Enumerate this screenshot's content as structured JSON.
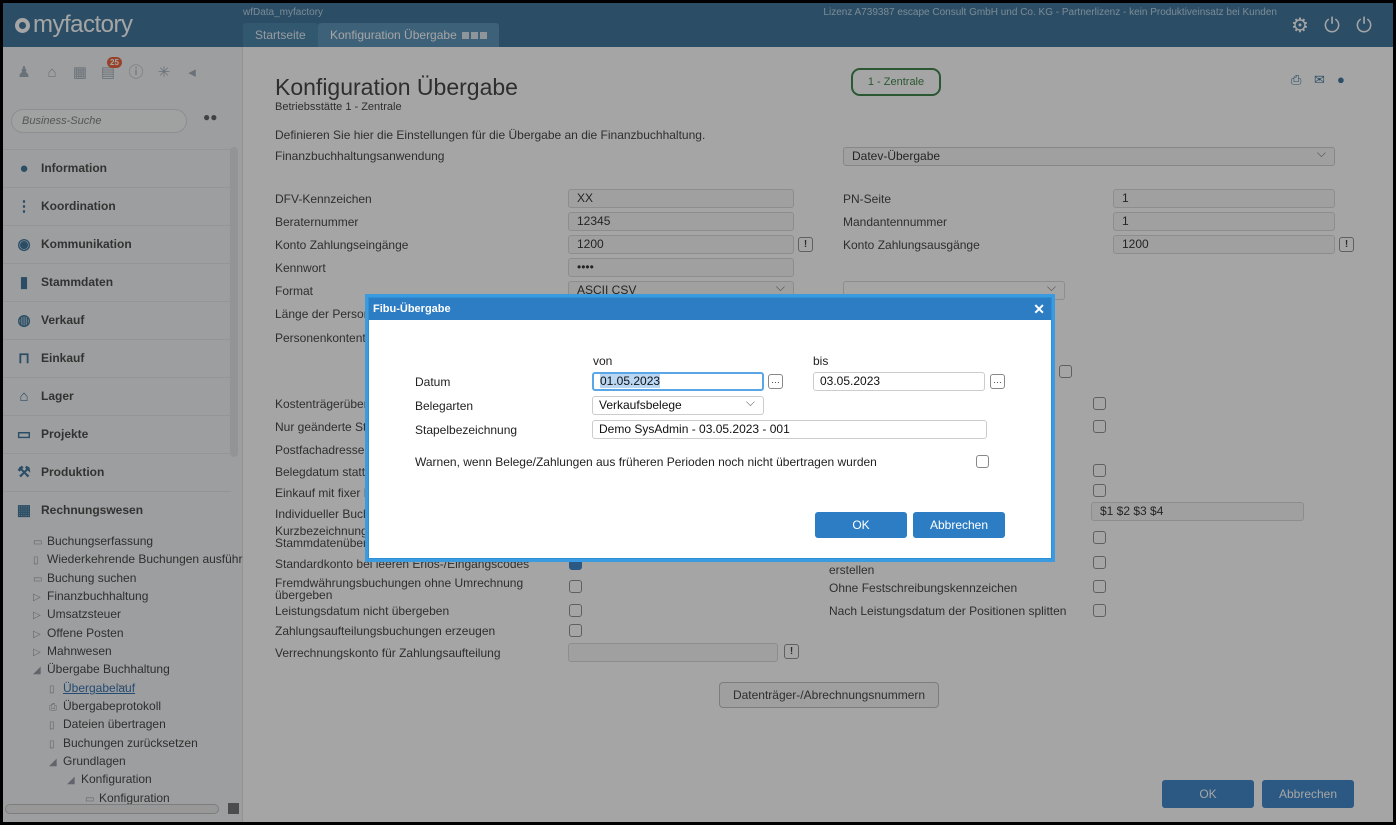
{
  "app": {
    "logo": "myfactory",
    "database": "wfData_myfactory",
    "license": "Lizenz A739387 escape Consult GmbH und Co. KG - Partnerlizenz - kein Produktiveinsatz bei Kunden",
    "tabs": [
      {
        "label": "Startseite"
      },
      {
        "label": "Konfiguration Übergabe"
      }
    ]
  },
  "sidebar": {
    "notification_count": "25",
    "search_placeholder": "Business-Suche",
    "nav": [
      {
        "label": "Information"
      },
      {
        "label": "Koordination"
      },
      {
        "label": "Kommunikation"
      },
      {
        "label": "Stammdaten"
      },
      {
        "label": "Verkauf"
      },
      {
        "label": "Einkauf"
      },
      {
        "label": "Lager"
      },
      {
        "label": "Projekte"
      },
      {
        "label": "Produktion"
      },
      {
        "label": "Rechnungswesen"
      }
    ],
    "tree": [
      {
        "label": "Buchungserfassung"
      },
      {
        "label": "Wiederkehrende Buchungen ausführe"
      },
      {
        "label": "Buchung suchen"
      },
      {
        "label": "Finanzbuchhaltung"
      },
      {
        "label": "Umsatzsteuer"
      },
      {
        "label": "Offene Posten"
      },
      {
        "label": "Mahnwesen"
      },
      {
        "label": "Übergabe Buchhaltung"
      },
      {
        "label": "Übergabelauf"
      },
      {
        "label": "Übergabeprotokoll"
      },
      {
        "label": "Dateien übertragen"
      },
      {
        "label": "Buchungen zurücksetzen"
      },
      {
        "label": "Grundlagen"
      },
      {
        "label": "Konfiguration"
      },
      {
        "label": "Konfiguration"
      }
    ]
  },
  "page": {
    "title": "Konfiguration Übergabe",
    "subtitle": "Betriebsstätte 1 - Zentrale",
    "site_pill": "1 - Zentrale",
    "intro": "Definieren Sie hier die Einstellungen für die Übergabe an die Finanzbuchhaltung.",
    "fibu_app_label": "Finanzbuchhaltungsanwendung",
    "fibu_app_value": "Datev-Übergabe",
    "fields": {
      "dfv_label": "DFV-Kennzeichen",
      "dfv_value": "XX",
      "berater_label": "Beraternummer",
      "berater_value": "12345",
      "konto_ein_label": "Konto Zahlungseingänge",
      "konto_ein_value": "1200",
      "kennwort_label": "Kennwort",
      "kennwort_value": "••••",
      "format_label": "Format",
      "format_value": "ASCII CSV",
      "pn_label": "PN-Seite",
      "pn_value": "1",
      "mandant_label": "Mandantennummer",
      "mandant_value": "1",
      "konto_aus_label": "Konto Zahlungsausgänge",
      "konto_aus_value": "1200",
      "laenge_label": "Länge der Persone",
      "personen_label": "Personenkontentra",
      "kosten_label": "Kostenträgerüberg",
      "nur_label": "Nur geänderte Star",
      "postfach_label": "Postfachadressen",
      "belegdatum_label": "Belegdatum statt F",
      "einkauf_label": "Einkauf mit fixer Be",
      "individuell_label": "Individueller Buchu",
      "individuell_value": "$1 $2 $3 $4",
      "kurz_label1": "Kurzbezeichnung s",
      "kurz_label2": "Stammdatenüberg",
      "standard_label": "Standardkonto bei leeren Erlös-/Eingangscodes",
      "fremd_label1": "Fremdwährungsbuchungen ohne Umrechnung",
      "fremd_label2": "übergeben",
      "leistung_label": "Leistungsdatum nicht übergeben",
      "zahlung_label": "Zahlungsaufteilungsbuchungen erzeugen",
      "verrechnung_label": "Verrechnungskonto für Zahlungsaufteilung",
      "erstellen_label": "erstellen",
      "festschreibung_label": "Ohne Festschreibungskennzeichen",
      "split_label": "Nach Leistungsdatum der Positionen splitten"
    },
    "datentraeger_button": "Datenträger-/Abrechnungsnummern",
    "ok_button": "OK",
    "cancel_button": "Abbrechen"
  },
  "dialog": {
    "title": "Fibu-Übergabe",
    "from_label": "von",
    "to_label": "bis",
    "date_label": "Datum",
    "date_from": "01.05.2023",
    "date_to": "03.05.2023",
    "belegarten_label": "Belegarten",
    "belegarten_value": "Verkaufsbelege",
    "stapel_label": "Stapelbezeichnung",
    "stapel_value": "Demo SysAdmin - 03.05.2023 - 001",
    "warn_label": "Warnen, wenn Belege/Zahlungen aus früheren Perioden noch nicht übertragen wurden",
    "ok_button": "OK",
    "cancel_button": "Abbrechen"
  }
}
